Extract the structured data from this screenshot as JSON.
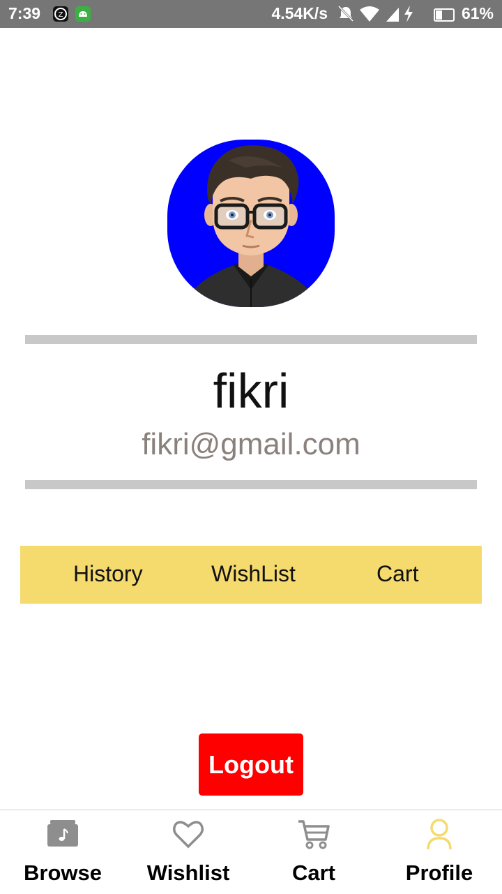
{
  "status_bar": {
    "time": "7:39",
    "speed": "4.54K/s",
    "battery": "61%",
    "icons": [
      "zepp-icon",
      "android-icon",
      "mute-icon",
      "wifi-icon",
      "signal-icon",
      "charging-icon",
      "battery-icon"
    ]
  },
  "profile": {
    "username": "fikri",
    "email": "fikri@gmail.com",
    "avatar_background": "#0000ff"
  },
  "tabs": [
    {
      "label": "History"
    },
    {
      "label": "WishList"
    },
    {
      "label": "Cart"
    }
  ],
  "logout_label": "Logout",
  "bottom_nav": {
    "items": [
      {
        "label": "Browse",
        "icon": "music-folder-icon"
      },
      {
        "label": "Wishlist",
        "icon": "heart-icon"
      },
      {
        "label": "Cart",
        "icon": "cart-icon"
      },
      {
        "label": "Profile",
        "icon": "person-icon",
        "active": true
      }
    ],
    "active_color": "#f5da6e",
    "inactive_color": "#8e8e8e"
  },
  "colors": {
    "tab_bar": "#f5da6e",
    "logout": "#ff0000",
    "status_bar": "#767676",
    "divider": "#c8c8c8"
  }
}
